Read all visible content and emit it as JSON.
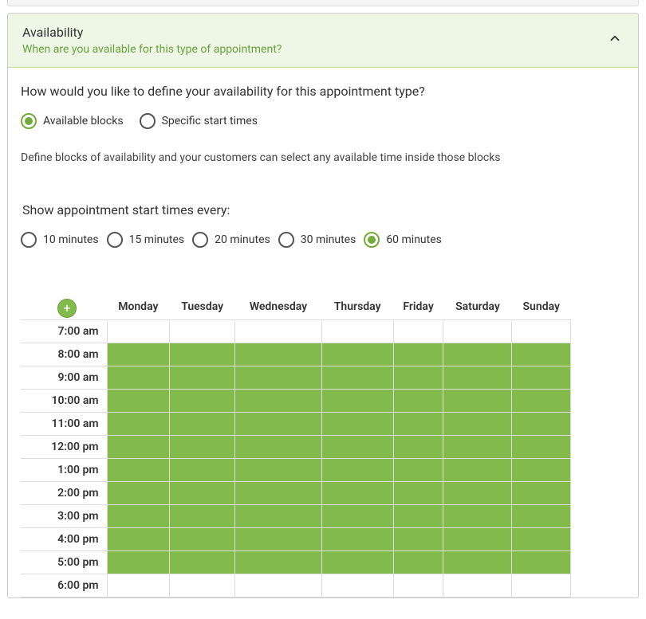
{
  "panel": {
    "title": "Availability",
    "subtitle": "When are you available for this type of appointment?"
  },
  "definition": {
    "question": "How would you like to define your availability for this appointment type?",
    "options": [
      {
        "label": "Available blocks",
        "checked": true
      },
      {
        "label": "Specific start times",
        "checked": false
      }
    ],
    "help_text": "Define blocks of availability and your customers can select any available time inside those blocks"
  },
  "interval": {
    "question": "Show appointment start times every:",
    "options": [
      {
        "label": "10 minutes",
        "checked": false
      },
      {
        "label": "15 minutes",
        "checked": false
      },
      {
        "label": "20 minutes",
        "checked": false
      },
      {
        "label": "30 minutes",
        "checked": false
      },
      {
        "label": "60 minutes",
        "checked": true
      }
    ]
  },
  "add_button_label": "+",
  "schedule": {
    "days": [
      "Monday",
      "Tuesday",
      "Wednesday",
      "Thursday",
      "Friday",
      "Saturday",
      "Sunday"
    ],
    "rows": [
      {
        "time": "7:00 am",
        "available": [
          false,
          false,
          false,
          false,
          false,
          false,
          false
        ]
      },
      {
        "time": "8:00 am",
        "available": [
          true,
          true,
          true,
          true,
          true,
          true,
          true
        ]
      },
      {
        "time": "9:00 am",
        "available": [
          true,
          true,
          true,
          true,
          true,
          true,
          true
        ]
      },
      {
        "time": "10:00 am",
        "available": [
          true,
          true,
          true,
          true,
          true,
          true,
          true
        ]
      },
      {
        "time": "11:00 am",
        "available": [
          true,
          true,
          true,
          true,
          true,
          true,
          true
        ]
      },
      {
        "time": "12:00 pm",
        "available": [
          true,
          true,
          true,
          true,
          true,
          true,
          true
        ]
      },
      {
        "time": "1:00 pm",
        "available": [
          true,
          true,
          true,
          true,
          true,
          true,
          true
        ]
      },
      {
        "time": "2:00 pm",
        "available": [
          true,
          true,
          true,
          true,
          true,
          true,
          true
        ]
      },
      {
        "time": "3:00 pm",
        "available": [
          true,
          true,
          true,
          true,
          true,
          true,
          true
        ]
      },
      {
        "time": "4:00 pm",
        "available": [
          true,
          true,
          true,
          true,
          true,
          true,
          true
        ]
      },
      {
        "time": "5:00 pm",
        "available": [
          true,
          true,
          true,
          true,
          true,
          true,
          true
        ]
      },
      {
        "time": "6:00 pm",
        "available": [
          false,
          false,
          false,
          false,
          false,
          false,
          false
        ]
      }
    ]
  }
}
